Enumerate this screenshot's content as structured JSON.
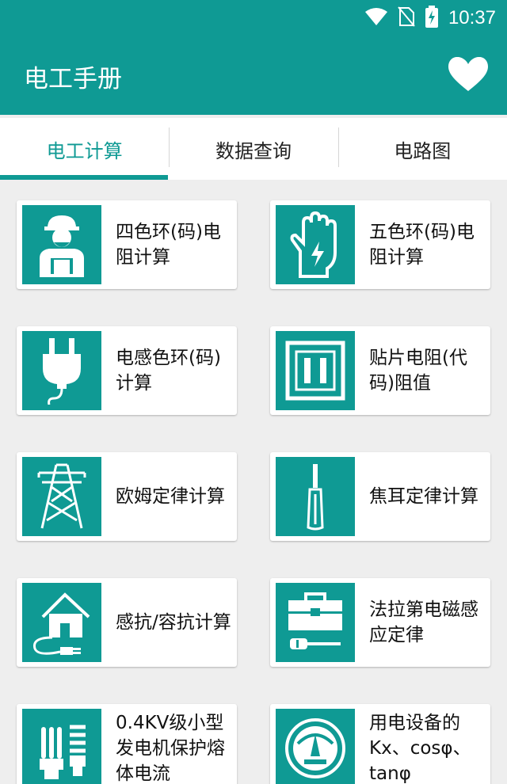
{
  "status": {
    "time": "10:37"
  },
  "app": {
    "title": "电工手册"
  },
  "tabs": [
    "电工计算",
    "数据查询",
    "电路图"
  ],
  "items": [
    {
      "label": "四色环(码)电阻计算",
      "icon": "worker-icon"
    },
    {
      "label": "五色环(码)电阻计算",
      "icon": "insulated-glove-icon"
    },
    {
      "label": "电感色环(码)计算",
      "icon": "power-plug-icon"
    },
    {
      "label": "贴片电阻(代码)阻值",
      "icon": "smd-resistor-icon"
    },
    {
      "label": "欧姆定律计算",
      "icon": "transmission-tower-icon"
    },
    {
      "label": "焦耳定律计算",
      "icon": "screwdriver-icon"
    },
    {
      "label": "感抗/容抗计算",
      "icon": "house-plug-icon"
    },
    {
      "label": "法拉第电磁感应定律",
      "icon": "toolbox-icon"
    },
    {
      "label": "0.4KV级小型发电机保护熔体电流",
      "icon": "cfl-bulbs-icon"
    },
    {
      "label": "用电设备的Kx、cosφ、tanφ",
      "icon": "meter-gauge-icon"
    }
  ],
  "colors": {
    "primary": "#0f9a94",
    "background": "#eeeeee"
  }
}
